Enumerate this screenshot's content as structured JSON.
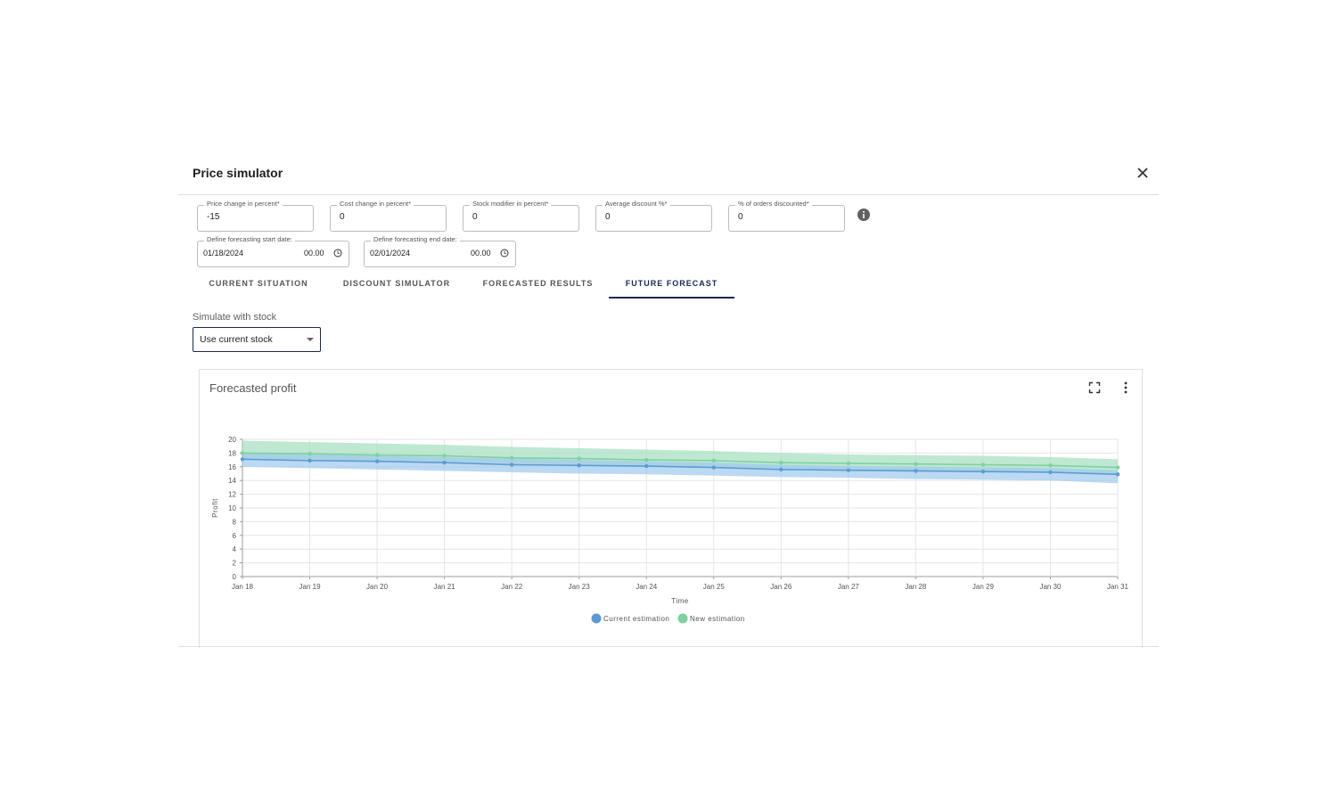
{
  "dialog": {
    "title": "Price simulator",
    "close_icon": "close-icon"
  },
  "params": {
    "price_change": {
      "label": "Price change in percent*",
      "value": "-15"
    },
    "cost_change": {
      "label": "Cost change in percent*",
      "value": "0"
    },
    "stock_modifier": {
      "label": "Stock modifier in percent*",
      "value": "0"
    },
    "avg_discount": {
      "label": "Average discount %*",
      "value": "0"
    },
    "orders_discounted": {
      "label": "% of orders discounted*",
      "value": "0"
    },
    "info_icon": "info-icon"
  },
  "dates": {
    "start": {
      "label": "Define forecasting start date:",
      "date": "01/18/2024",
      "time": "00.00"
    },
    "end": {
      "label": "Define forecasting end date:",
      "date": "02/01/2024",
      "time": "00.00"
    }
  },
  "tabs": [
    {
      "label": "CURRENT SITUATION",
      "active": false
    },
    {
      "label": "DISCOUNT SIMULATOR",
      "active": false
    },
    {
      "label": "FORECASTED RESULTS",
      "active": false
    },
    {
      "label": "FUTURE FORECAST",
      "active": true
    }
  ],
  "stock": {
    "label": "Simulate with stock",
    "selected": "Use current stock"
  },
  "card": {
    "title": "Forecasted profit",
    "icons": [
      "fullscreen-icon",
      "more-vert-icon"
    ]
  },
  "colors": {
    "current_line": "#5b9bd5",
    "current_band": "#9ec9ec",
    "new_line": "#7fd1a0",
    "new_band": "#a8e0c2",
    "accent": "#1a2a4a"
  },
  "chart_data": {
    "type": "line",
    "xlabel": "Time",
    "ylabel": "Profit",
    "ylim": [
      0,
      20
    ],
    "yticks": [
      0,
      2,
      4,
      6,
      8,
      10,
      12,
      14,
      16,
      18,
      20
    ],
    "categories": [
      "Jan 18",
      "Jan 19",
      "Jan 20",
      "Jan 21",
      "Jan 22",
      "Jan 23",
      "Jan 24",
      "Jan 25",
      "Jan 26",
      "Jan 27",
      "Jan 28",
      "Jan 29",
      "Jan 30",
      "Jan 31"
    ],
    "grid": true,
    "legend_position": "bottom",
    "series": [
      {
        "name": "Current estimation",
        "values": [
          17.1,
          16.9,
          16.8,
          16.6,
          16.3,
          16.2,
          16.1,
          15.9,
          15.6,
          15.5,
          15.4,
          15.3,
          15.2,
          14.9
        ],
        "band_upper": [
          18.0,
          17.8,
          17.6,
          17.4,
          17.2,
          17.0,
          16.8,
          16.6,
          16.3,
          16.1,
          16.0,
          15.9,
          15.8,
          15.5
        ],
        "band_lower": [
          16.0,
          15.8,
          15.6,
          15.4,
          15.2,
          15.0,
          14.9,
          14.7,
          14.5,
          14.4,
          14.2,
          14.1,
          14.0,
          13.6
        ]
      },
      {
        "name": "New estimation",
        "values": [
          18.0,
          17.9,
          17.7,
          17.6,
          17.3,
          17.2,
          17.0,
          16.9,
          16.6,
          16.5,
          16.4,
          16.3,
          16.2,
          15.9
        ],
        "band_upper": [
          19.8,
          19.6,
          19.4,
          19.2,
          18.9,
          18.7,
          18.5,
          18.3,
          18.0,
          17.8,
          17.7,
          17.6,
          17.4,
          17.1
        ],
        "band_lower": [
          17.2,
          17.0,
          16.9,
          16.7,
          16.4,
          16.3,
          16.1,
          16.0,
          15.7,
          15.6,
          15.5,
          15.4,
          15.3,
          15.0
        ]
      }
    ]
  }
}
